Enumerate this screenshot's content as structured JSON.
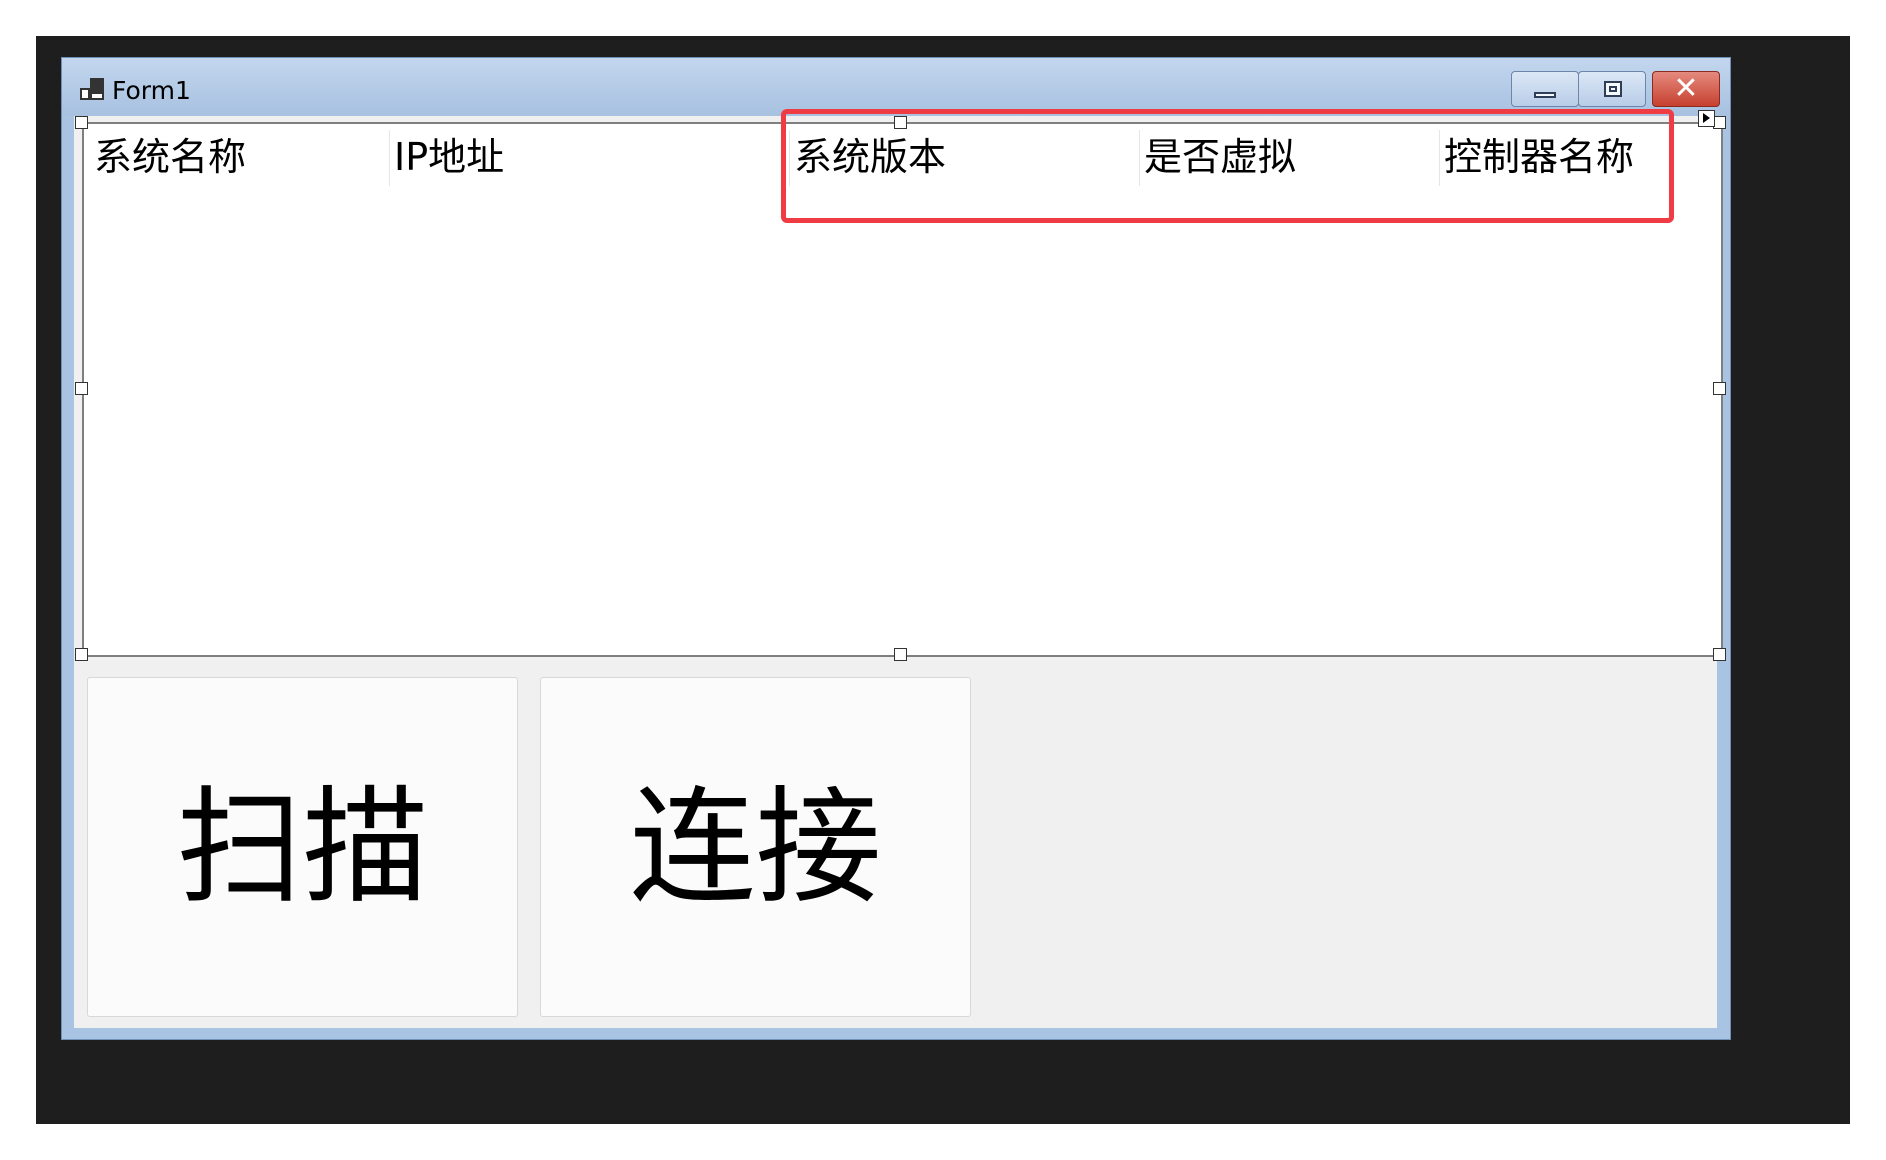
{
  "window": {
    "title": "Form1"
  },
  "titlebar": {
    "minimize_icon": "minimize-icon",
    "maximize_icon": "maximize-icon",
    "close_icon": "close-icon",
    "close_glyph": "✕"
  },
  "listview": {
    "columns": [
      {
        "label": "系统名称"
      },
      {
        "label": "IP地址"
      },
      {
        "label": "系统版本"
      },
      {
        "label": "是否虚拟"
      },
      {
        "label": "控制器名称"
      }
    ],
    "rows": []
  },
  "buttons": {
    "scan_label": "扫描",
    "connect_label": "连接"
  },
  "colors": {
    "highlight_box": "#ef3b44",
    "title_bar": "#a9c4e2",
    "close_button": "#c7402f"
  }
}
